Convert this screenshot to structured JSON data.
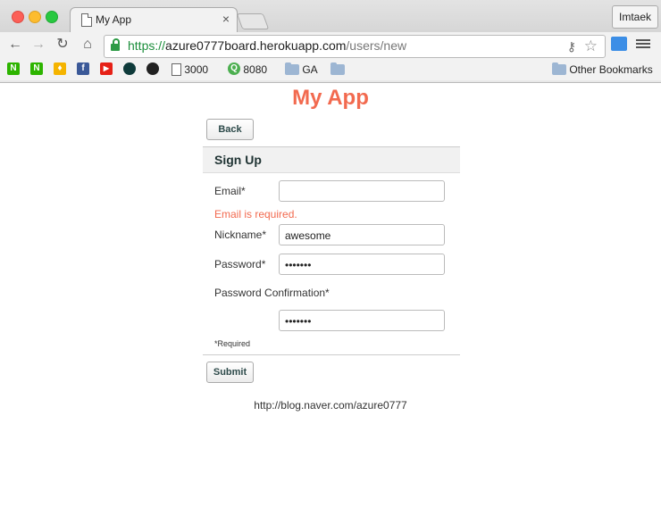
{
  "browser": {
    "tab_title": "My App",
    "tab_close": "×",
    "profile_name": "Imtaek",
    "url_scheme": "https://",
    "url_host": "azure0777board.herokuapp.com",
    "url_path": "/users/new",
    "nav": {
      "back": "←",
      "forward": "→",
      "reload": "↻",
      "home": "⌂"
    },
    "bookmarks": [
      {
        "icon": "naver-icon",
        "color": "#2db400",
        "glyph": "N"
      },
      {
        "icon": "naver-icon",
        "color": "#2db400",
        "glyph": "N"
      },
      {
        "icon": "keep-icon",
        "color": "#f5b400",
        "glyph": "♦"
      },
      {
        "icon": "facebook-icon",
        "color": "#3b5998",
        "glyph": "f"
      },
      {
        "icon": "youtube-icon",
        "color": "#e62117",
        "glyph": "▶"
      },
      {
        "icon": "circle-app-icon",
        "color": "#0f3b3b",
        "glyph": "●"
      },
      {
        "icon": "github-icon",
        "color": "#222222",
        "glyph": "●"
      }
    ],
    "bookmark_3000": "3000",
    "bookmark_8080": "8080",
    "bookmark_ga": "GA",
    "other_bookmarks": "Other Bookmarks"
  },
  "page": {
    "app_title": "My App",
    "back_button": "Back",
    "form_heading": "Sign Up",
    "email_label": "Email*",
    "email_value": "",
    "email_error": "Email is required.",
    "nickname_label": "Nickname*",
    "nickname_value": "awesome",
    "password_label": "Password*",
    "password_value": "•••••••",
    "password_confirmation_label": "Password Confirmation*",
    "password_confirmation_value": "•••••••",
    "required_note": "*Required",
    "submit_button": "Submit",
    "footer_link": "http://blog.naver.com/azure0777"
  },
  "colors": {
    "accent": "#f26a4f",
    "secure_green": "#1a8d3a"
  }
}
